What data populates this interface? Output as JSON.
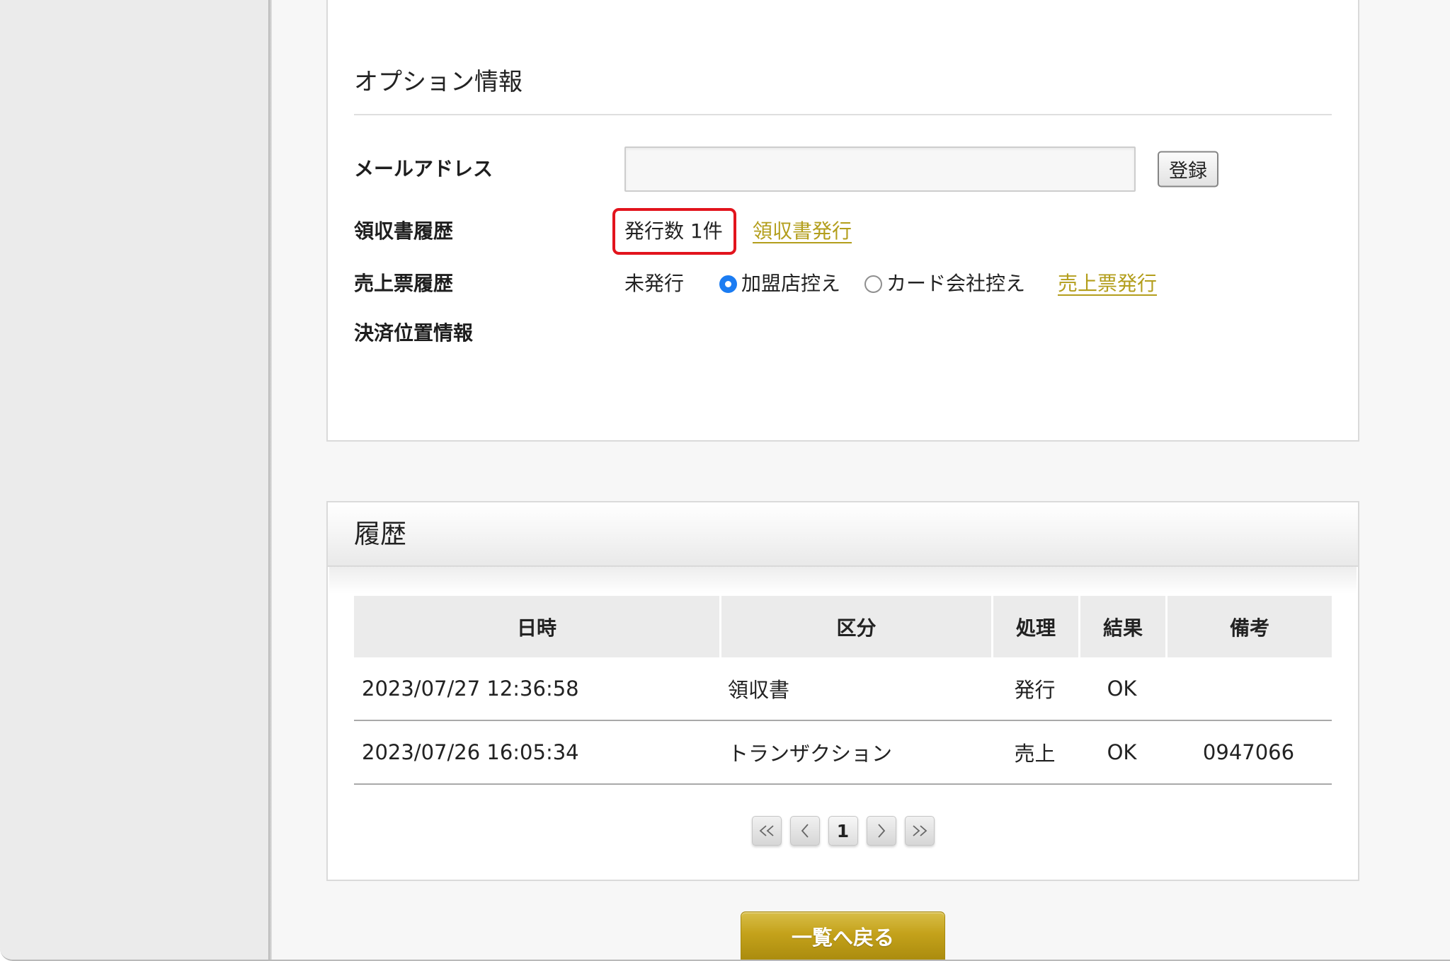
{
  "option_panel": {
    "title": "オプション情報",
    "email": {
      "label": "メールアドレス",
      "value": "",
      "button_label": "登録"
    },
    "receipt_history": {
      "label": "領収書履歴",
      "issued_count": "発行数 1件",
      "issue_link": "領収書発行"
    },
    "sales_slip_history": {
      "label": "売上票履歴",
      "status": "未発行",
      "copy_options": [
        {
          "label": "加盟店控え",
          "checked": true
        },
        {
          "label": "カード会社控え",
          "checked": false
        }
      ],
      "issue_link": "売上票発行"
    },
    "payment_location": {
      "label": "決済位置情報"
    }
  },
  "history_panel": {
    "title": "履歴",
    "columns": [
      "日時",
      "区分",
      "処理",
      "結果",
      "備考"
    ],
    "rows": [
      {
        "datetime": "2023/07/27 12:36:58",
        "category": "領収書",
        "process": "発行",
        "result": "OK",
        "note": ""
      },
      {
        "datetime": "2023/07/26 16:05:34",
        "category": "トランザクション",
        "process": "売上",
        "result": "OK",
        "note": "0947066"
      }
    ],
    "pagination": {
      "first_icon": "double-chevron-left-icon",
      "prev_icon": "chevron-left-icon",
      "current_page": "1",
      "next_icon": "chevron-right-icon",
      "last_icon": "double-chevron-right-icon"
    }
  },
  "back_button_label": "一覧へ戻る",
  "colors": {
    "link": "#b39e1c",
    "highlight_border": "#e2141d",
    "button_gold": "#c4a21b",
    "radio_checked": "#1b7cf2"
  }
}
